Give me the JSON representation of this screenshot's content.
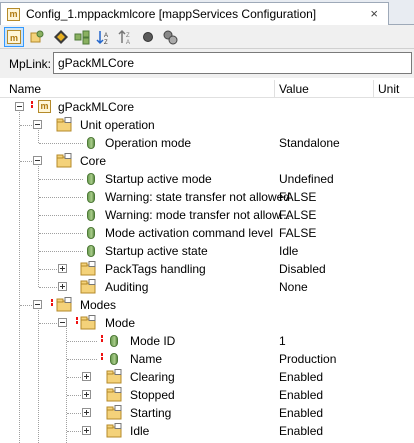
{
  "tab": {
    "title": "Config_1.mppackmlcore [mappServices Configuration]",
    "icon": "mapp-config-icon",
    "close": "×"
  },
  "toolbar": {
    "buttons": [
      "show-mapp-icon",
      "filter-icon",
      "diamond-icon",
      "expand-icon",
      "sort-ascending-icon",
      "sort-descending-icon",
      "record-icon",
      "settings-icon"
    ]
  },
  "mplink": {
    "label": "MpLink:",
    "value": "gPackMLCore"
  },
  "columns": {
    "name": "Name",
    "value": "Value",
    "unit": "Unit"
  },
  "tree": [
    {
      "name": "gPackMLCore",
      "value": "",
      "type": "root"
    },
    {
      "name": "Unit operation",
      "value": "",
      "type": "folder"
    },
    {
      "name": "Operation mode",
      "value": "Standalone",
      "type": "leaf"
    },
    {
      "name": "Core",
      "value": "",
      "type": "folder"
    },
    {
      "name": "Startup active mode",
      "value": "Undefined",
      "type": "leaf"
    },
    {
      "name": "Warning: state transfer not allowed",
      "value": "FALSE",
      "type": "leaf"
    },
    {
      "name": "Warning: mode transfer not allow...",
      "value": "FALSE",
      "type": "leaf"
    },
    {
      "name": "Mode activation command level",
      "value": "FALSE",
      "type": "leaf"
    },
    {
      "name": "Startup active state",
      "value": "Idle",
      "type": "leaf"
    },
    {
      "name": "PackTags handling",
      "value": "Disabled",
      "type": "folder"
    },
    {
      "name": "Auditing",
      "value": "None",
      "type": "folder"
    },
    {
      "name": "Modes",
      "value": "",
      "type": "folder"
    },
    {
      "name": "Mode",
      "value": "",
      "type": "folder"
    },
    {
      "name": "Mode ID",
      "value": "1",
      "type": "leaf"
    },
    {
      "name": "Name",
      "value": "Production",
      "type": "leaf"
    },
    {
      "name": "Clearing",
      "value": "Enabled",
      "type": "folder"
    },
    {
      "name": "Stopped",
      "value": "Enabled",
      "type": "folder"
    },
    {
      "name": "Starting",
      "value": "Enabled",
      "type": "folder"
    },
    {
      "name": "Idle",
      "value": "Enabled",
      "type": "folder"
    }
  ]
}
